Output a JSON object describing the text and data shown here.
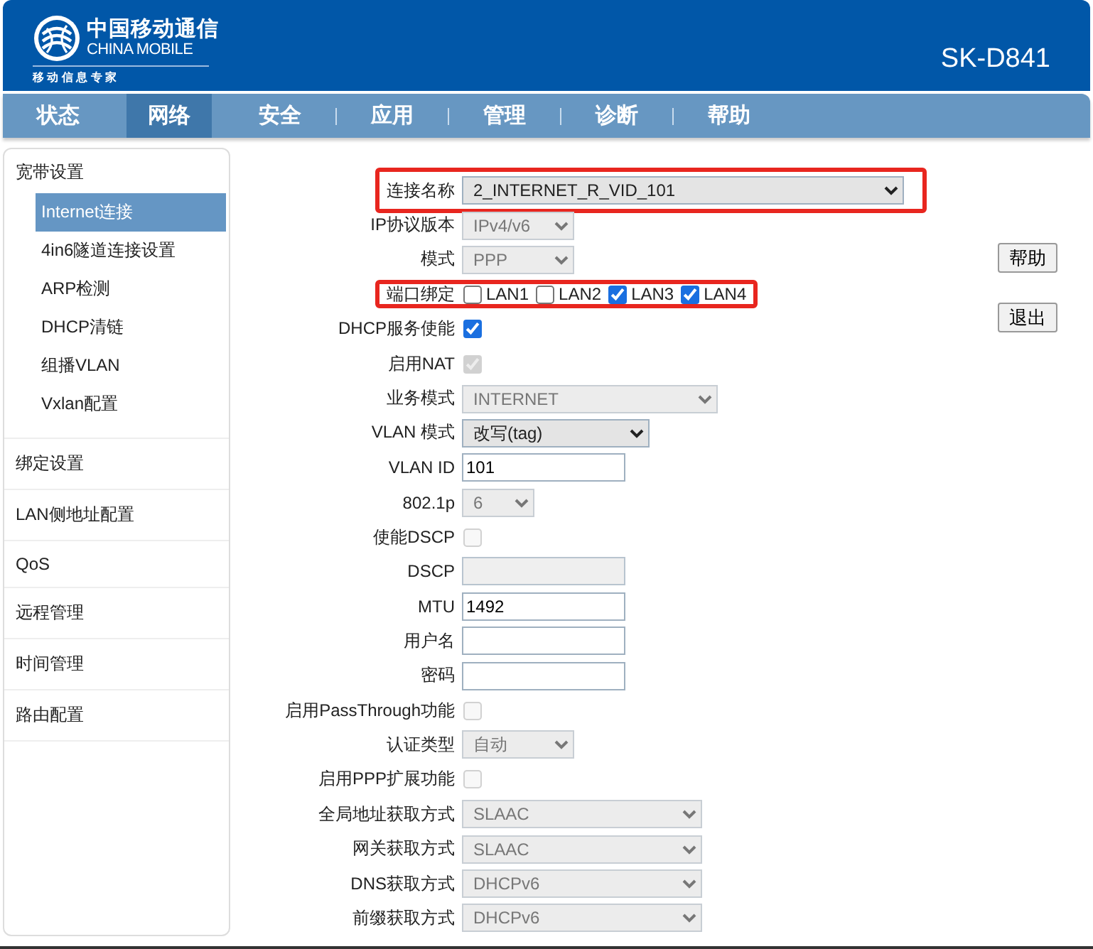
{
  "header": {
    "brand_cn": "中国移动通信",
    "brand_en": "CHINA MOBILE",
    "slogan": "移 动 信 息 专 家",
    "model": "SK-D841"
  },
  "tabs": [
    {
      "label": "状态",
      "selected": false
    },
    {
      "label": "网络",
      "selected": true
    },
    {
      "label": "安全",
      "selected": false
    },
    {
      "label": "应用",
      "selected": false
    },
    {
      "label": "管理",
      "selected": false
    },
    {
      "label": "诊断",
      "selected": false
    },
    {
      "label": "帮助",
      "selected": false
    }
  ],
  "sidebar": {
    "items": [
      {
        "label": "宽带设置",
        "children": [
          {
            "label": "Internet连接",
            "selected": true
          },
          {
            "label": "4in6隧道连接设置",
            "selected": false
          },
          {
            "label": "ARP检测",
            "selected": false
          },
          {
            "label": "DHCP清链",
            "selected": false
          },
          {
            "label": "组播VLAN",
            "selected": false
          },
          {
            "label": "Vxlan配置",
            "selected": false
          }
        ]
      },
      {
        "label": "绑定设置"
      },
      {
        "label": "LAN侧地址配置"
      },
      {
        "label": "QoS"
      },
      {
        "label": "远程管理"
      },
      {
        "label": "时间管理"
      },
      {
        "label": "路由配置"
      }
    ]
  },
  "form": [
    {
      "kind": "select",
      "label": "连接名称",
      "value": "2_INTERNET_R_VID_101",
      "disabled": false,
      "highlighted": true
    },
    {
      "kind": "select",
      "label": "IP协议版本",
      "value": "IPv4/v6",
      "disabled": true
    },
    {
      "kind": "select",
      "label": "模式",
      "value": "PPP",
      "disabled": true
    },
    {
      "kind": "checks",
      "label": "端口绑定",
      "highlighted": true,
      "options": [
        {
          "label": "LAN1",
          "checked": false
        },
        {
          "label": "LAN2",
          "checked": false
        },
        {
          "label": "LAN3",
          "checked": true
        },
        {
          "label": "LAN4",
          "checked": true
        }
      ]
    },
    {
      "kind": "checkbox",
      "label": "DHCP服务使能",
      "checked": true,
      "disabled": false
    },
    {
      "kind": "checkbox",
      "label": "启用NAT",
      "checked": true,
      "disabled": true
    },
    {
      "kind": "select",
      "label": "业务模式",
      "value": "INTERNET",
      "disabled": true
    },
    {
      "kind": "select",
      "label": "VLAN 模式",
      "value": "改写(tag)",
      "disabled": false
    },
    {
      "kind": "text",
      "label": "VLAN ID",
      "value": "101",
      "disabled": false
    },
    {
      "kind": "select",
      "label": "802.1p",
      "value": "6",
      "disabled": true
    },
    {
      "kind": "checkbox",
      "label": "使能DSCP",
      "checked": false,
      "disabled": true
    },
    {
      "kind": "text",
      "label": "DSCP",
      "disabled": true
    },
    {
      "kind": "text",
      "label": "MTU",
      "value": "1492",
      "disabled": false
    },
    {
      "kind": "text",
      "label": "用户名",
      "disabled": false
    },
    {
      "kind": "text",
      "label": "密码",
      "disabled": false
    },
    {
      "kind": "checkbox",
      "label": "启用PassThrough功能",
      "checked": false,
      "disabled": true
    },
    {
      "kind": "select",
      "label": "认证类型",
      "value": "自动",
      "disabled": true
    },
    {
      "kind": "checkbox",
      "label": "启用PPP扩展功能",
      "checked": false,
      "disabled": true
    },
    {
      "kind": "select",
      "label": "全局地址获取方式",
      "value": "SLAAC",
      "disabled": true
    },
    {
      "kind": "select",
      "label": "网关获取方式",
      "value": "SLAAC",
      "disabled": true
    },
    {
      "kind": "select",
      "label": "DNS获取方式",
      "value": "DHCPv6",
      "disabled": true
    },
    {
      "kind": "select",
      "label": "前缀获取方式",
      "value": "DHCPv6",
      "disabled": true
    }
  ],
  "buttons": [
    "帮助",
    "退出"
  ]
}
